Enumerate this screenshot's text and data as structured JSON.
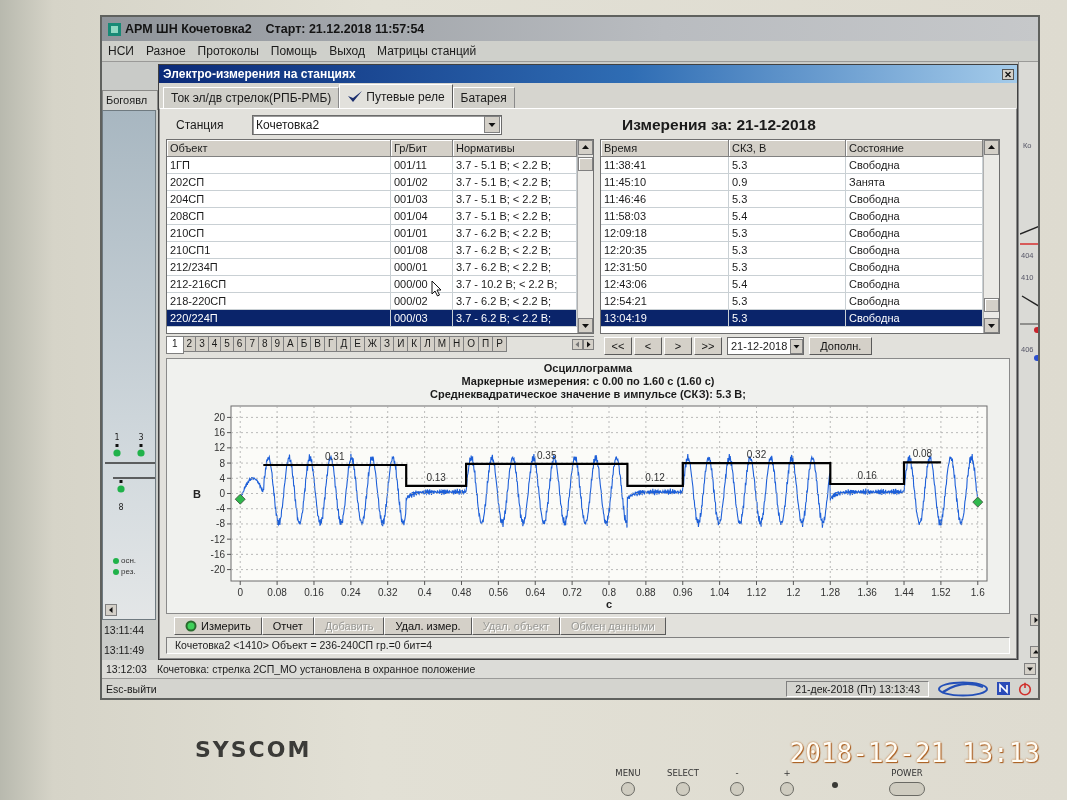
{
  "app": {
    "title": "АРМ ШН Кочетовка2",
    "start": "Старт: 21.12.2018 11:57:54",
    "menu": [
      "НСИ",
      "Разное",
      "Протоколы",
      "Помощь",
      "Выход",
      "Матрицы станций"
    ]
  },
  "left_panel": {
    "tab": "Богоявл",
    "signal_labels": [
      "1",
      "3",
      "8"
    ],
    "legend": [
      "осн.",
      "рез."
    ],
    "log_times": [
      "13:11:44",
      "13:11:49"
    ]
  },
  "dialog": {
    "title": "Электро-измерения на станциях",
    "tabs": [
      {
        "label": "Ток эл/дв стрелок(РПБ-РМБ)",
        "selected": false
      },
      {
        "label": "Путевые реле",
        "selected": true
      },
      {
        "label": "Батарея",
        "selected": false
      }
    ],
    "station": {
      "label": "Станция",
      "value": "Кочетовка2"
    },
    "objects_table": {
      "columns": [
        "Объект",
        "Гр/Бит",
        "Нормативы"
      ],
      "rows": [
        {
          "cells": [
            "1ГП",
            "001/11",
            "3.7 - 5.1 В; < 2.2 В;"
          ],
          "selected": false
        },
        {
          "cells": [
            "202СП",
            "001/02",
            "3.7 - 5.1 В; < 2.2 В;"
          ],
          "selected": false
        },
        {
          "cells": [
            "204СП",
            "001/03",
            "3.7 - 5.1 В; < 2.2 В;"
          ],
          "selected": false
        },
        {
          "cells": [
            "208СП",
            "001/04",
            "3.7 - 5.1 В; < 2.2 В;"
          ],
          "selected": false
        },
        {
          "cells": [
            "210СП",
            "001/01",
            "3.7 - 6.2 В; < 2.2 В;"
          ],
          "selected": false
        },
        {
          "cells": [
            "210СП1",
            "001/08",
            "3.7 - 6.2 В; < 2.2 В;"
          ],
          "selected": false
        },
        {
          "cells": [
            "212/234П",
            "000/01",
            "3.7 - 6.2 В; < 2.2 В;"
          ],
          "selected": false
        },
        {
          "cells": [
            "212-216СП",
            "000/00",
            "3.7 - 10.2 В; < 2.2 В;"
          ],
          "selected": false
        },
        {
          "cells": [
            "218-220СП",
            "000/02",
            "3.7 - 6.2 В; < 2.2 В;"
          ],
          "selected": false
        },
        {
          "cells": [
            "220/224П",
            "000/03",
            "3.7 - 6.2 В; < 2.2 В;"
          ],
          "selected": true
        }
      ]
    },
    "index_tabs": [
      {
        "label": "1",
        "selected": true
      },
      {
        "label": "2",
        "selected": false
      },
      {
        "label": "3",
        "selected": false
      },
      {
        "label": "4",
        "selected": false
      },
      {
        "label": "5",
        "selected": false
      },
      {
        "label": "6",
        "selected": false
      },
      {
        "label": "7",
        "selected": false
      },
      {
        "label": "8",
        "selected": false
      },
      {
        "label": "9",
        "selected": false
      },
      {
        "label": "А",
        "selected": false
      },
      {
        "label": "Б",
        "selected": false
      },
      {
        "label": "В",
        "selected": false
      },
      {
        "label": "Г",
        "selected": false
      },
      {
        "label": "Д",
        "selected": false
      },
      {
        "label": "Е",
        "selected": false
      },
      {
        "label": "Ж",
        "selected": false
      },
      {
        "label": "З",
        "selected": false
      },
      {
        "label": "И",
        "selected": false
      },
      {
        "label": "К",
        "selected": false
      },
      {
        "label": "Л",
        "selected": false
      },
      {
        "label": "М",
        "selected": false
      },
      {
        "label": "Н",
        "selected": false
      },
      {
        "label": "О",
        "selected": false
      },
      {
        "label": "П",
        "selected": false
      },
      {
        "label": "Р",
        "selected": false
      }
    ],
    "measurements": {
      "heading": "Измерения за: 21-12-2018",
      "columns": [
        "Время",
        "СКЗ, В",
        "Состояние"
      ],
      "rows": [
        {
          "cells": [
            "11:38:41",
            "5.3",
            "Свободна"
          ],
          "selected": false
        },
        {
          "cells": [
            "11:45:10",
            "0.9",
            "Занята"
          ],
          "selected": false
        },
        {
          "cells": [
            "11:46:46",
            "5.3",
            "Свободна"
          ],
          "selected": false
        },
        {
          "cells": [
            "11:58:03",
            "5.4",
            "Свободна"
          ],
          "selected": false
        },
        {
          "cells": [
            "12:09:18",
            "5.3",
            "Свободна"
          ],
          "selected": false
        },
        {
          "cells": [
            "12:20:35",
            "5.3",
            "Свободна"
          ],
          "selected": false
        },
        {
          "cells": [
            "12:31:50",
            "5.3",
            "Свободна"
          ],
          "selected": false
        },
        {
          "cells": [
            "12:43:06",
            "5.4",
            "Свободна"
          ],
          "selected": false
        },
        {
          "cells": [
            "12:54:21",
            "5.3",
            "Свободна"
          ],
          "selected": false
        },
        {
          "cells": [
            "13:04:19",
            "5.3",
            "Свободна"
          ],
          "selected": true
        }
      ]
    },
    "navigation": {
      "buttons": [
        "<<",
        "<",
        ">",
        ">>"
      ],
      "date": "21-12-2018",
      "more": "Дополн."
    },
    "oscillogram": {
      "subtitle": "Маркерные измерения: с 0.00 по 1.60 с (1.60 с)",
      "rms": "Среднеквадратическое значение в импульсе (СКЗ): 5.3 В;",
      "chart_data": {
        "type": "line",
        "title": "Осциллограмма",
        "xlabel": "с",
        "ylabel": "В",
        "grid": true,
        "x": [
          0.05,
          0.36,
          0.36,
          0.49,
          0.49,
          0.84,
          0.84,
          0.96,
          0.96,
          1.28,
          1.28,
          1.44,
          1.44,
          1.52
        ],
        "series": [
          {
            "color": "#000000",
            "values": [
              7.5,
              7.5,
              2.0,
              2.0,
              7.8,
              7.8,
              2.0,
              2.0,
              8.0,
              8.0,
              2.5,
              2.5,
              8.2,
              8.2
            ]
          }
        ],
        "xlim": [
          -0.02,
          1.62
        ],
        "ylim": [
          -23,
          23
        ],
        "xticks": [
          0,
          0.08,
          0.16,
          0.24,
          0.32,
          0.4,
          0.48,
          0.56,
          0.64,
          0.72,
          0.8,
          0.88,
          0.96,
          1.04,
          1.12,
          1.2,
          1.28,
          1.36,
          1.44,
          1.52,
          1.6
        ],
        "yticks": [
          -20,
          -16,
          -12,
          -8,
          -4,
          0,
          4,
          8,
          12,
          16,
          20
        ],
        "annotations": [
          "0.31",
          "0.13",
          "0.35",
          "0.12",
          "0.32",
          "0.16",
          "0.08"
        ]
      }
    },
    "actions": [
      {
        "label": "Измерить",
        "kind": "icon",
        "disabled": false
      },
      {
        "label": "Отчет",
        "kind": "plain",
        "disabled": false
      },
      {
        "label": "Добавить",
        "kind": "plain",
        "disabled": true
      },
      {
        "label": "Удал. измер.",
        "kind": "plain",
        "disabled": false
      },
      {
        "label": "Удал. объект",
        "kind": "plain",
        "disabled": true
      },
      {
        "label": "Обмен данными",
        "kind": "plain",
        "disabled": true
      }
    ],
    "status": "Кочетовка2 <1410> Объект = 236-240СП гр.=0 бит=4"
  },
  "right_panel": {
    "labels": [
      "Ко",
      "404",
      "410",
      "406"
    ]
  },
  "log": {
    "time": "13:12:03",
    "message": "Кочетовка: стрелка 2СП_МО установлена в охранное положение"
  },
  "status_bar": {
    "hint": "Esc-выйти",
    "datetime": "21-дек-2018 (Пт) 13:13:43"
  },
  "monitor": {
    "brand": "SYSCOM",
    "controls": [
      {
        "label": "MENU",
        "kind": "button"
      },
      {
        "label": "SELECT",
        "kind": "button"
      },
      {
        "label": "-",
        "kind": "button"
      },
      {
        "label": "+",
        "kind": "button"
      },
      {
        "kind": "led"
      },
      {
        "label": "POWER",
        "kind": "power"
      }
    ]
  },
  "photo_timestamp": "2018-12-21 13:13"
}
